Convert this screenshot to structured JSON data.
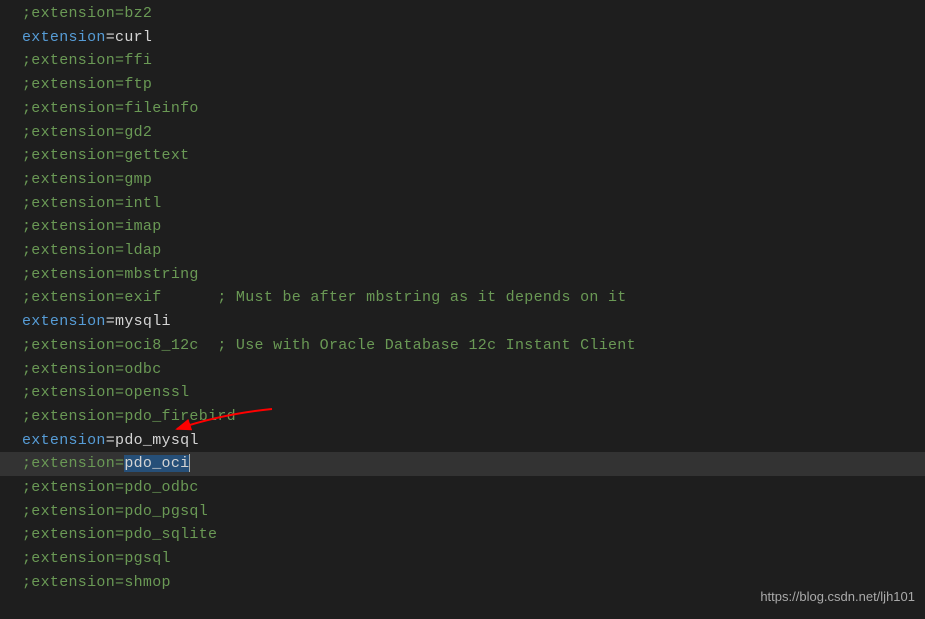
{
  "lines": [
    {
      "type": "comment",
      "text": ";extension=bz2"
    },
    {
      "type": "active",
      "key": "extension",
      "value": "curl"
    },
    {
      "type": "comment",
      "text": ";extension=ffi"
    },
    {
      "type": "comment",
      "text": ";extension=ftp"
    },
    {
      "type": "comment",
      "text": ";extension=fileinfo"
    },
    {
      "type": "comment",
      "text": ";extension=gd2"
    },
    {
      "type": "comment",
      "text": ";extension=gettext"
    },
    {
      "type": "comment",
      "text": ";extension=gmp"
    },
    {
      "type": "comment",
      "text": ";extension=intl"
    },
    {
      "type": "comment",
      "text": ";extension=imap"
    },
    {
      "type": "comment",
      "text": ";extension=ldap"
    },
    {
      "type": "comment",
      "text": ";extension=mbstring"
    },
    {
      "type": "comment",
      "text": ";extension=exif      ; Must be after mbstring as it depends on it"
    },
    {
      "type": "active",
      "key": "extension",
      "value": "mysqli"
    },
    {
      "type": "comment",
      "text": ";extension=oci8_12c  ; Use with Oracle Database 12c Instant Client"
    },
    {
      "type": "comment",
      "text": ";extension=odbc"
    },
    {
      "type": "comment",
      "text": ";extension=openssl"
    },
    {
      "type": "comment",
      "text": ";extension=pdo_firebird"
    },
    {
      "type": "active",
      "key": "extension",
      "value": "pdo_mysql"
    },
    {
      "type": "highlighted",
      "prefix": ";extension=",
      "selected": "pdo_oci"
    },
    {
      "type": "comment",
      "text": ";extension=pdo_odbc"
    },
    {
      "type": "comment",
      "text": ";extension=pdo_pgsql"
    },
    {
      "type": "comment",
      "text": ";extension=pdo_sqlite"
    },
    {
      "type": "comment",
      "text": ";extension=pgsql"
    },
    {
      "type": "comment",
      "text": ";extension=shmop"
    }
  ],
  "watermark": "https://blog.csdn.net/ljh101",
  "colors": {
    "background": "#1e1e1e",
    "comment": "#6a9955",
    "keyword": "#569cd6",
    "text": "#d4d4d4",
    "highlight": "#333333",
    "selection": "#264f78",
    "arrow": "#ff0000"
  }
}
